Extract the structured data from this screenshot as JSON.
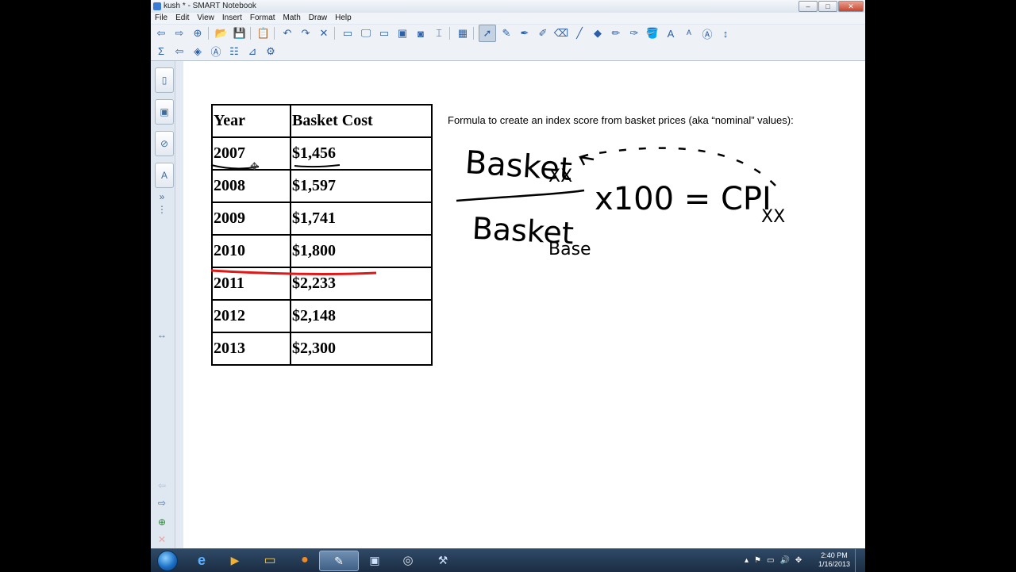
{
  "window": {
    "title": "kush * - SMART Notebook",
    "controls": [
      "–",
      "□",
      "✕"
    ]
  },
  "menu": [
    "File",
    "Edit",
    "View",
    "Insert",
    "Format",
    "Math",
    "Draw",
    "Help"
  ],
  "toolbar1": [
    {
      "icon": "back-arrow-icon",
      "glyph": "⇦"
    },
    {
      "icon": "forward-arrow-icon",
      "glyph": "⇨"
    },
    {
      "icon": "add-page-icon",
      "glyph": "⊕"
    },
    {
      "sep": true
    },
    {
      "icon": "open-icon",
      "glyph": "📂"
    },
    {
      "icon": "save-icon",
      "glyph": "💾"
    },
    {
      "sep": true
    },
    {
      "icon": "paste-icon",
      "glyph": "📋"
    },
    {
      "sep": true
    },
    {
      "icon": "undo-icon",
      "glyph": "↶"
    },
    {
      "icon": "redo-icon",
      "glyph": "↷"
    },
    {
      "icon": "delete-icon",
      "glyph": "✕"
    },
    {
      "sep": true
    },
    {
      "icon": "screen-shade-icon",
      "glyph": "▭"
    },
    {
      "icon": "full-screen-icon",
      "glyph": "🖵"
    },
    {
      "icon": "dual-page-icon",
      "glyph": "▭"
    },
    {
      "icon": "screen-capture-icon",
      "glyph": "▣"
    },
    {
      "icon": "document-camera-icon",
      "glyph": "◙"
    },
    {
      "icon": "capture-tool-icon",
      "glyph": "⌶"
    },
    {
      "sep": true
    },
    {
      "icon": "table-icon",
      "glyph": "▦"
    },
    {
      "sep": true
    },
    {
      "icon": "select-icon",
      "glyph": "➚",
      "selected": true
    },
    {
      "icon": "pen-icon",
      "glyph": "✎"
    },
    {
      "icon": "creative-pen-icon",
      "glyph": "✒"
    },
    {
      "icon": "highlighter-icon",
      "glyph": "✐"
    },
    {
      "icon": "eraser-icon",
      "glyph": "⌫"
    },
    {
      "icon": "line-icon",
      "glyph": "╱"
    },
    {
      "icon": "shapes-icon",
      "glyph": "◆"
    },
    {
      "icon": "magic-pen-icon",
      "glyph": "✏"
    },
    {
      "icon": "shape-recognition-pen-icon",
      "glyph": "✑"
    },
    {
      "icon": "fill-icon",
      "glyph": "🪣"
    },
    {
      "icon": "text-color-icon",
      "glyph": "A"
    },
    {
      "icon": "font-icon",
      "glyph": "ᴬ"
    },
    {
      "icon": "text-tool-icon",
      "glyph": "Ⓐ"
    },
    {
      "icon": "more-icon",
      "glyph": "↕"
    }
  ],
  "toolbar2": [
    {
      "icon": "math-sigma-icon",
      "glyph": "Σ"
    },
    {
      "icon": "toolbar-arrow-icon",
      "glyph": "⇦"
    },
    {
      "icon": "object-animation-icon",
      "glyph": "◈"
    },
    {
      "icon": "text-recognition-icon",
      "glyph": "Ⓐ"
    },
    {
      "icon": "properties-icon",
      "glyph": "☷"
    },
    {
      "icon": "graph-icon",
      "glyph": "⊿"
    },
    {
      "icon": "addon-icon",
      "glyph": "⚙"
    }
  ],
  "side_tabs": [
    {
      "icon": "page-sorter-icon",
      "glyph": "▯"
    },
    {
      "icon": "gallery-icon",
      "glyph": "▣"
    },
    {
      "icon": "attachments-icon",
      "glyph": "⊘"
    },
    {
      "icon": "properties-tab-icon",
      "glyph": "A"
    }
  ],
  "table": {
    "headers": [
      "Year",
      "Basket Cost"
    ],
    "rows": [
      [
        "2007",
        "$1,456"
      ],
      [
        "2008",
        "$1,597"
      ],
      [
        "2009",
        "$1,741"
      ],
      [
        "2010",
        "$1,800"
      ],
      [
        "2011",
        "$2,233"
      ],
      [
        "2012",
        "$2,148"
      ],
      [
        "2013",
        "$2,300"
      ]
    ]
  },
  "formula_label": "Formula to create an index score from basket prices (aka “nominal” values):",
  "ink_text": {
    "numerator": "Basket",
    "numerator_sub": "XX",
    "denominator": "Basket",
    "denominator_sub": "Base",
    "equation": "x100 = CPI",
    "result_sub": "XX"
  },
  "ink_colors": {
    "black": "#000000",
    "red": "#e01818"
  },
  "taskbar": {
    "clock_time": "2:40 PM",
    "clock_date": "1/16/2013",
    "tray_icons": [
      "▴",
      "⚑",
      "▭",
      "🔊",
      "✥"
    ]
  }
}
